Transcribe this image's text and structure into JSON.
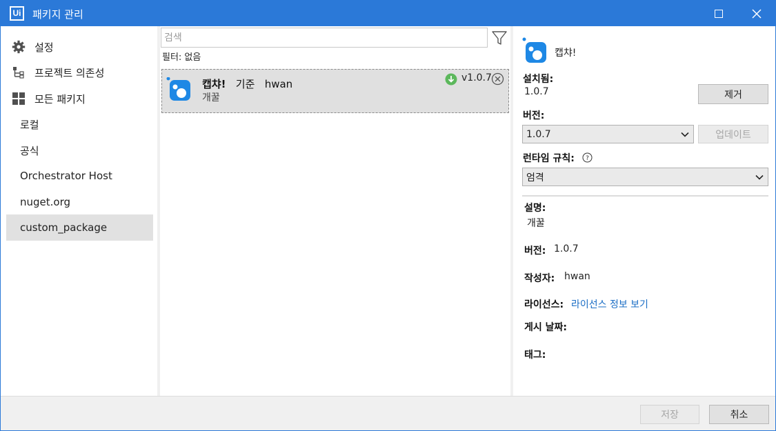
{
  "titlebar": {
    "logo_text": "Ui",
    "title": "패키지 관리"
  },
  "sidebar": {
    "items": [
      {
        "label": "설정",
        "icon": "gear-icon"
      },
      {
        "label": "프로젝트 의존성",
        "icon": "tree-icon"
      },
      {
        "label": "모든 패키지",
        "icon": "grid-icon"
      },
      {
        "label": "로컬"
      },
      {
        "label": "공식"
      },
      {
        "label": "Orchestrator Host"
      },
      {
        "label": "nuget.org"
      },
      {
        "label": "custom_package",
        "selected": true
      }
    ]
  },
  "center": {
    "search_placeholder": "검색",
    "search_value": "",
    "filter_text": "필터: 없음",
    "package": {
      "name": "캡챠!",
      "by_label": "기준",
      "author": "hwan",
      "description": "개꿀",
      "version": "v1.0.7"
    }
  },
  "details": {
    "name": "캡챠!",
    "installed_label": "설치됨:",
    "installed_value": "1.0.7",
    "remove_button": "제거",
    "version_label": "버전:",
    "version_selected": "1.0.7",
    "update_button": "업데이트",
    "runtime_rule_label": "런타임 규칙:",
    "runtime_rule_selected": "엄격",
    "description_label": "설명:",
    "description_value": "개꿀",
    "version2_label": "버전:",
    "version2_value": "1.0.7",
    "author_label": "작성자:",
    "author_value": "hwan",
    "license_label": "라이선스:",
    "license_link": "라이선스 정보 보기",
    "published_label": "게시 날짜:",
    "tags_label": "태그:"
  },
  "footer": {
    "save_button": "저장",
    "cancel_button": "취소"
  },
  "colors": {
    "accent": "#2b79d8",
    "link": "#1a6dc5",
    "installed_green": "#5cb85c",
    "package_icon_blue": "#1e88e5"
  }
}
